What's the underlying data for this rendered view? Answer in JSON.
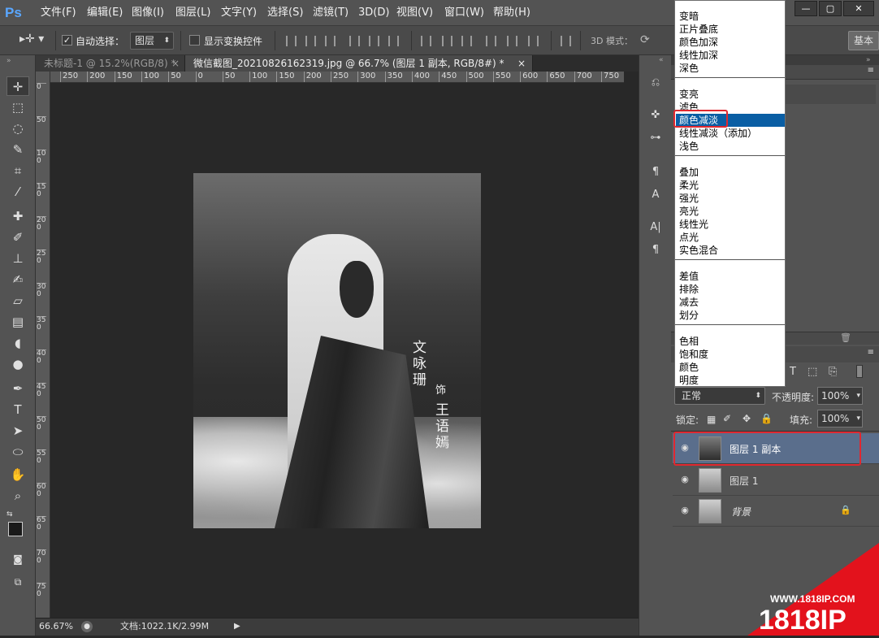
{
  "menu_bar": {
    "logo": "Ps",
    "items": [
      "文件(F)",
      "编辑(E)",
      "图像(I)",
      "图层(L)",
      "文字(Y)",
      "选择(S)",
      "滤镜(T)",
      "3D(D)",
      "视图(V)",
      "窗口(W)",
      "帮助(H)"
    ]
  },
  "options_bar": {
    "auto_select_label": "自动选择：",
    "auto_select_value": "图层",
    "show_transform_label": "显示变换控件",
    "mode_3d_label": "3D 模式：",
    "workspace_label": "基本"
  },
  "tabs": [
    {
      "label": "未标题-1 @ 15.2%(RGB/8) *",
      "close": "×"
    },
    {
      "label": "微信截图_20210826162319.jpg @ 66.7% (图层 1 副本, RGB/8#) *",
      "close": "×"
    }
  ],
  "ruler_h": [
    "250",
    "200",
    "150",
    "100",
    "50",
    "0",
    "50",
    "100",
    "150",
    "200",
    "250",
    "300",
    "350",
    "400",
    "450",
    "500",
    "550",
    "600",
    "650",
    "700",
    "750"
  ],
  "ruler_v": [
    "0",
    "5 0",
    "1 0 0",
    "1 5 0",
    "2 0 0",
    "2 5 0",
    "3 0 0",
    "3 5 0",
    "4 0 0",
    "4 5 0",
    "5 0 0",
    "5 5 0",
    "6 0 0",
    "6 5 0",
    "7 0 0",
    "7 5 0"
  ],
  "status": {
    "zoom": "66.67%",
    "doc": "文档:1022.1K/2.99M"
  },
  "photo_text": {
    "left": "文咏珊",
    "middle": "饰",
    "right": "王语嫣"
  },
  "blend_menu": {
    "groups": [
      [
        "变暗",
        "正片叠底",
        "颜色加深",
        "线性加深",
        "深色"
      ],
      [
        "变亮",
        "滤色",
        "颜色减淡",
        "线性减淡（添加）",
        "浅色"
      ],
      [
        "叠加",
        "柔光",
        "强光",
        "亮光",
        "线性光",
        "点光",
        "实色混合"
      ],
      [
        "差值",
        "排除",
        "减去",
        "划分"
      ],
      [
        "色相",
        "饱和度",
        "颜色",
        "明度"
      ]
    ],
    "selected": "颜色减淡"
  },
  "layers_panel": {
    "blend_mode": "正常",
    "opacity_label": "不透明度:",
    "opacity_value": "100%",
    "lock_label": "锁定:",
    "fill_label": "填充:",
    "fill_value": "100%",
    "layers": [
      {
        "name": "图层 1 副本",
        "selected": true
      },
      {
        "name": "图层 1",
        "selected": false
      },
      {
        "name": "背景",
        "selected": false
      }
    ]
  },
  "watermark": {
    "url": "WWW.1818IP.COM",
    "brand": "1818IP"
  },
  "colors": {
    "accent_blue": "#5aa7ff",
    "highlight": "#0a5ea4",
    "red_box": "#e0282f",
    "selected_layer": "#5a6e8c"
  }
}
